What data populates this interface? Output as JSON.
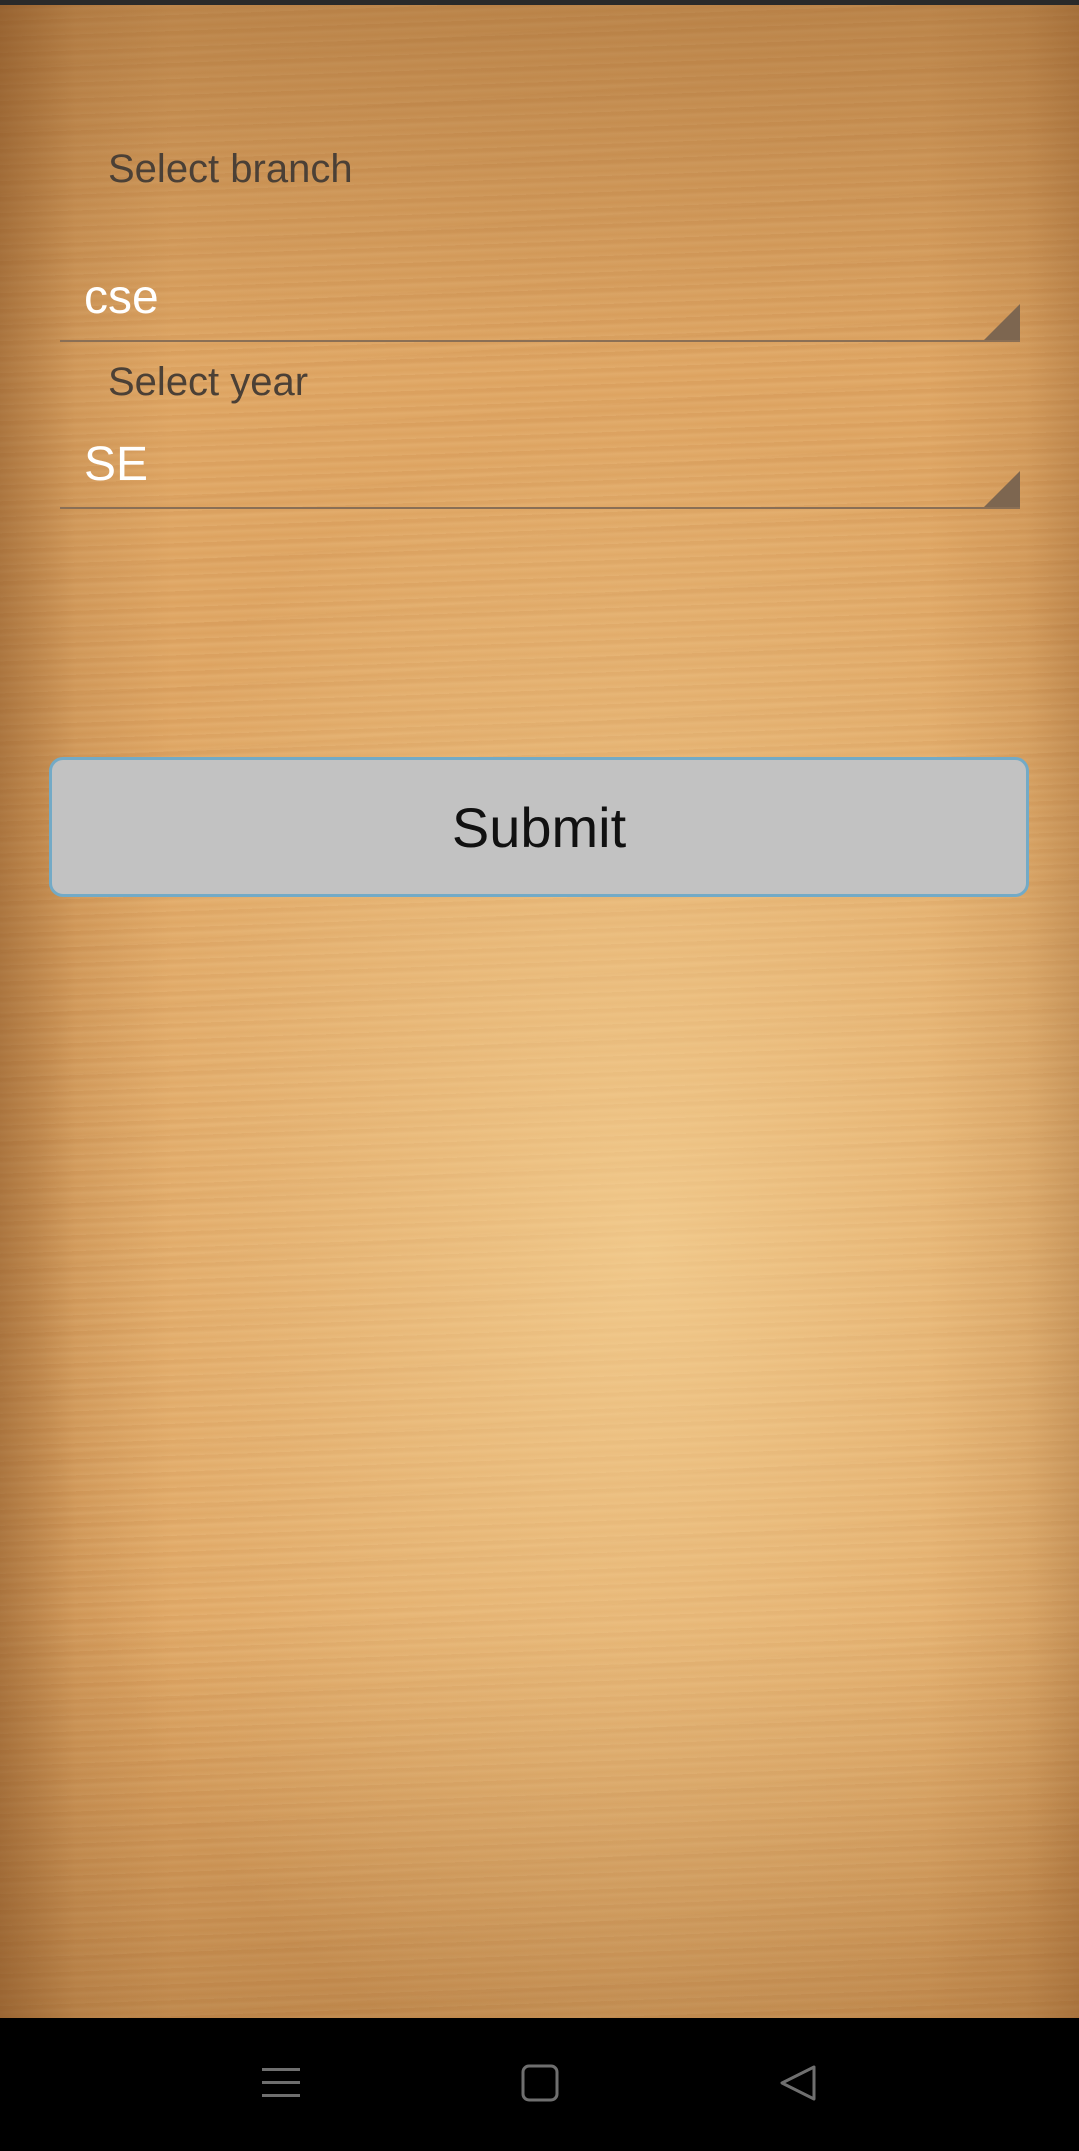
{
  "form": {
    "branch_label": "Select branch",
    "branch_value": "cse",
    "year_label": "Select year",
    "year_value": "SE",
    "submit_label": "Submit"
  },
  "nav_bar": {
    "buttons": [
      {
        "icon": "menu-icon"
      },
      {
        "icon": "home-square-icon"
      },
      {
        "icon": "back-triangle-icon"
      }
    ]
  },
  "colors": {
    "background_wood": "#e0a866",
    "button_fill": "#c2c2c2",
    "button_border": "#73aac6",
    "label_text": "#4b4036",
    "value_text": "#ffffff",
    "nav_bar": "#000000"
  }
}
